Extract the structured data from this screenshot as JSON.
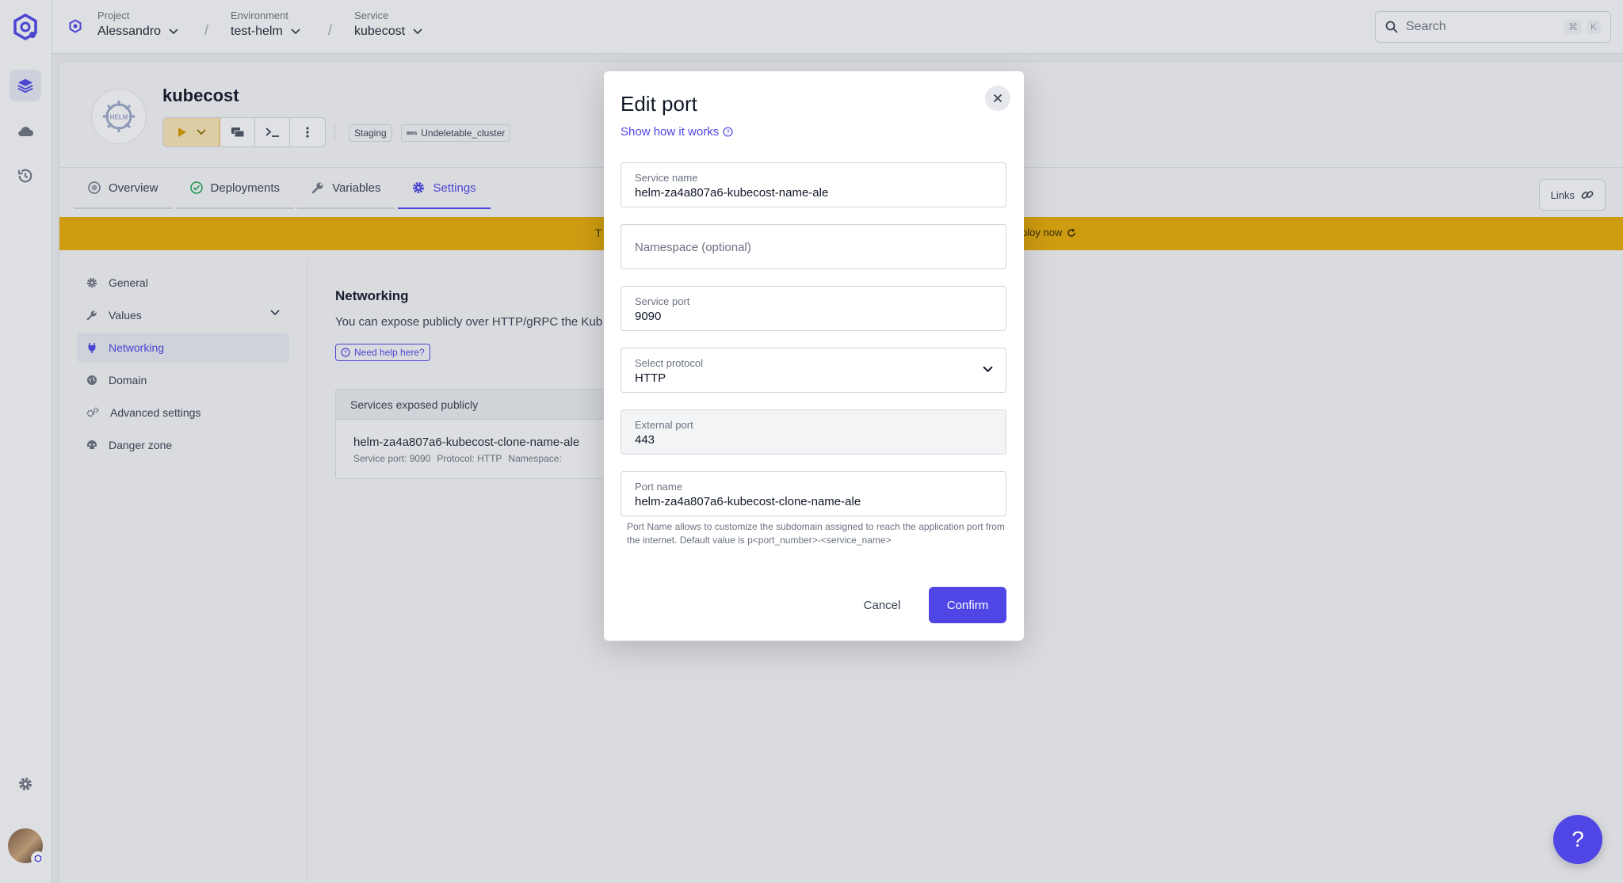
{
  "topbar": {
    "project": {
      "label": "Project",
      "value": "Alessandro"
    },
    "environment": {
      "label": "Environment",
      "value": "test-helm"
    },
    "service": {
      "label": "Service",
      "value": "kubecost"
    },
    "search": {
      "placeholder": "Search",
      "shortcut_mod": "⌘",
      "shortcut_key": "K"
    }
  },
  "service_header": {
    "title": "kubecost",
    "tags": [
      {
        "label": "Staging"
      },
      {
        "prefix": "aws",
        "label": "Undeletable_cluster"
      }
    ],
    "tabs": [
      {
        "label": "Overview"
      },
      {
        "label": "Deployments"
      },
      {
        "label": "Variables"
      },
      {
        "label": "Settings"
      }
    ],
    "links_label": "Links"
  },
  "banner": {
    "left_text": "T",
    "right_text": "ploy now"
  },
  "settings_menu": {
    "items": [
      {
        "label": "General"
      },
      {
        "label": "Values"
      },
      {
        "label": "Networking"
      },
      {
        "label": "Domain"
      },
      {
        "label": "Advanced settings"
      },
      {
        "label": "Danger zone"
      }
    ]
  },
  "networking": {
    "title": "Networking",
    "description": "You can expose publicly over HTTP/gRPC the Kub",
    "help_chip": "Need help here?",
    "table_header": "Services exposed publicly",
    "row": {
      "name": "helm-za4a807a6-kubecost-clone-name-ale",
      "service_port": "Service port: 9090",
      "protocol": "Protocol: HTTP",
      "namespace": "Namespace:"
    }
  },
  "modal": {
    "title": "Edit port",
    "how_link": "Show how it works",
    "fields": {
      "service_name": {
        "label": "Service name",
        "value": "helm-za4a807a6-kubecost-name-ale"
      },
      "namespace": {
        "placeholder": "Namespace (optional)"
      },
      "service_port": {
        "label": "Service port",
        "value": "9090"
      },
      "protocol": {
        "label": "Select protocol",
        "value": "HTTP"
      },
      "external_port": {
        "label": "External port",
        "value": "443"
      },
      "port_name": {
        "label": "Port name",
        "value": "helm-za4a807a6-kubecost-clone-name-ale"
      }
    },
    "hint": "Port Name allows to customize the subdomain assigned to reach the application port from the internet. Default value is p<port_number>-<service_name>",
    "cancel_label": "Cancel",
    "confirm_label": "Confirm"
  },
  "help_fab": "?",
  "colors": {
    "accent": "#4f46e5",
    "warning_banner": "#e3a90a"
  }
}
